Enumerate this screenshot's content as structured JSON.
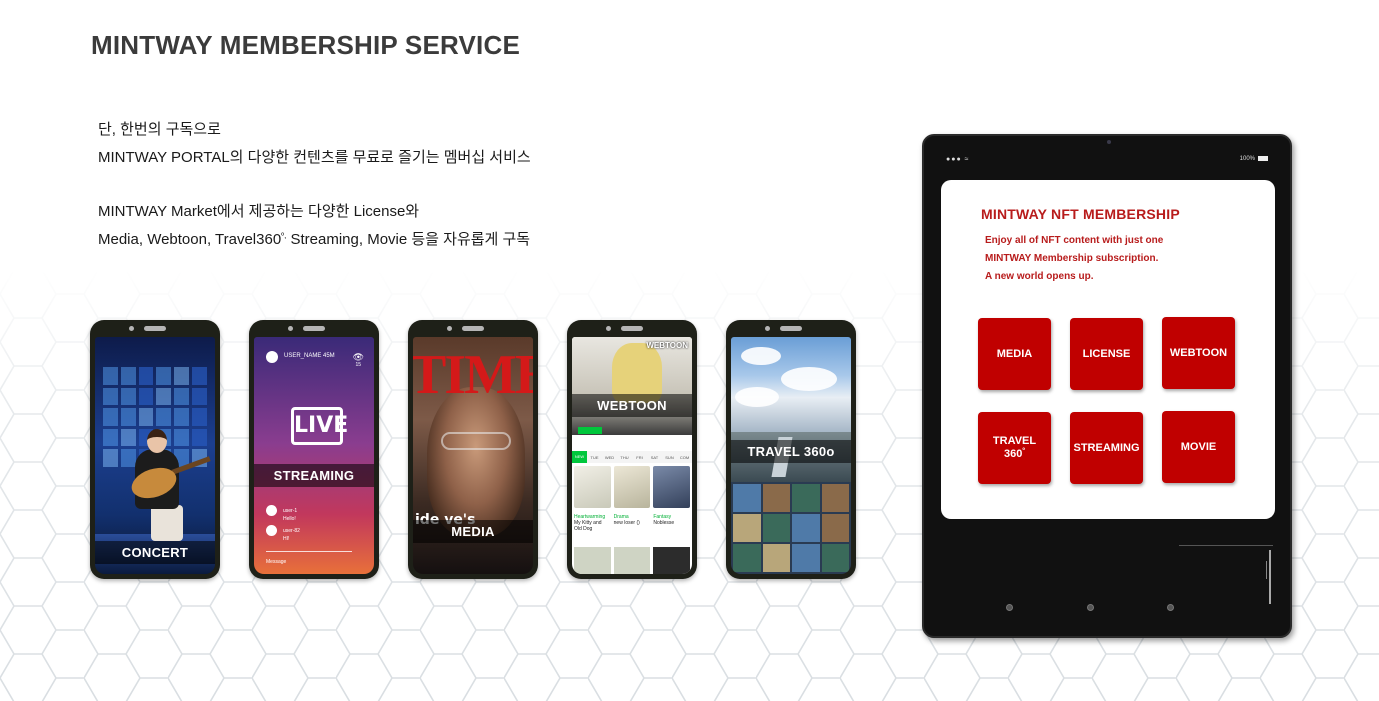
{
  "page": {
    "title": "MINTWAY MEMBERSHIP SERVICE"
  },
  "intro": {
    "line1": "단, 한번의 구독으로",
    "line2": "MINTWAY PORTAL의 다양한 컨텐츠를 무료로 즐기는 멤버십 서비스",
    "line3": "MINTWAY Market에서 제공하는 다양한 License와",
    "line4_pre": "Media, Webtoon, Travel360",
    "line4_sup": "º,",
    "line4_post": " Streaming, Movie 등을 자유롭게 구독"
  },
  "phones": [
    {
      "id": "concert",
      "label": "CONCERT"
    },
    {
      "id": "streaming",
      "label": "STREAMING",
      "username": "USER_NAME 45M",
      "viewer_count": "15",
      "chat": [
        {
          "user": "user-1",
          "text": "Hello!"
        },
        {
          "user": "user-82",
          "text": "HI!"
        }
      ],
      "message_placeholder": "Message"
    },
    {
      "id": "media",
      "label": "MEDIA",
      "magazine": "TIME",
      "side_text": "ide ve's"
    },
    {
      "id": "webtoon",
      "label": "WEBTOON",
      "brand": "WEBTOON",
      "tabs": [
        "NEW",
        "TUE",
        "WED",
        "THU",
        "FRI",
        "SAT",
        "SUN",
        "COM"
      ],
      "titles": [
        {
          "genre": "Heartwarming",
          "name": "My Kitty and Old Dog"
        },
        {
          "genre": "Drama",
          "name": "new loser ()"
        },
        {
          "genre": "Fantasy",
          "name": "Noblesse"
        }
      ]
    },
    {
      "id": "travel",
      "label": "TRAVEL 360o"
    }
  ],
  "tablet": {
    "status_left": "●●● ≈",
    "status_right": "100%",
    "card_title": "MINTWAY NFT MEMBERSHIP",
    "desc1": "Enjoy all of NFT content with just one",
    "desc2": "MINTWAY Membership subscription.",
    "desc3": "A new world opens up.",
    "tiles": {
      "media": "MEDIA",
      "license": "LICENSE",
      "webtoon": "WEBTOON",
      "travel": "TRAVEL",
      "travel_num": "360",
      "travel_sup": "º",
      "streaming": "STREAMING",
      "movie": "MOVIE"
    }
  },
  "colors": {
    "accent_red": "#c00000",
    "title_red": "#b81c1c",
    "title_gray": "#3b3b3b",
    "phone_frame": "#1e2018"
  }
}
